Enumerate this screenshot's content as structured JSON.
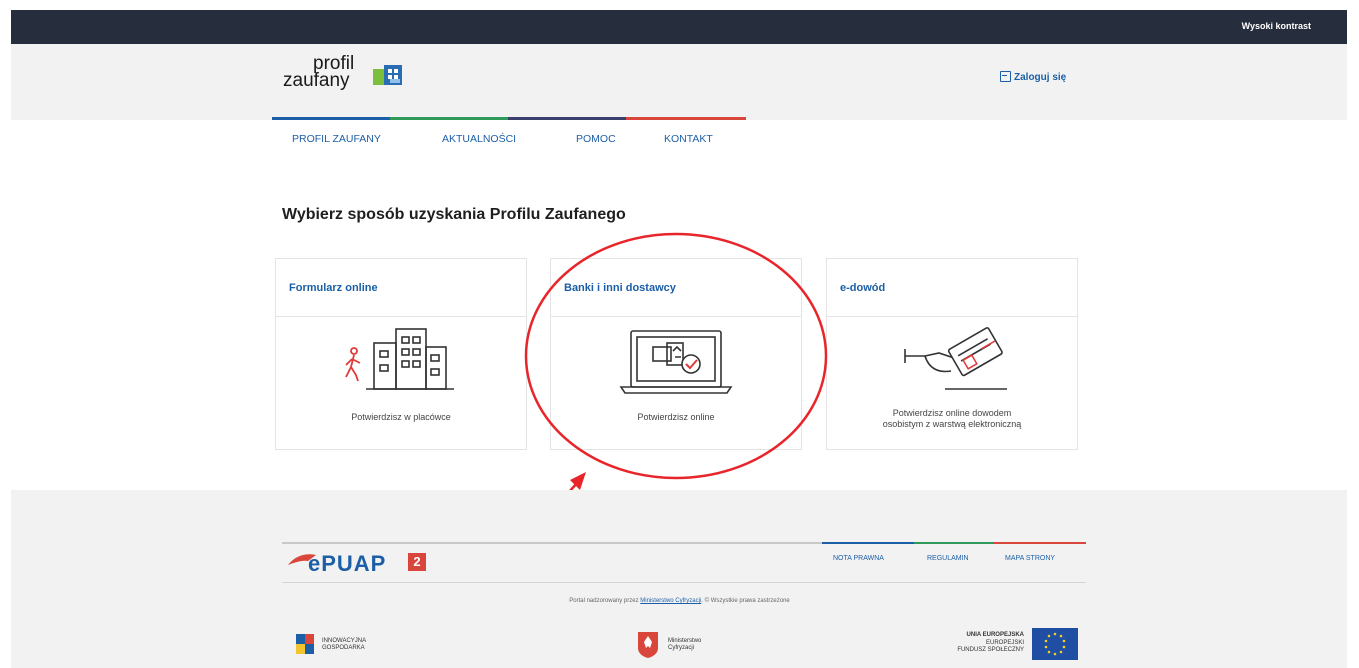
{
  "topbar": {
    "contrast_label": "Wysoki kontrast"
  },
  "header": {
    "logo_line1": "profil",
    "logo_line2": "zaufany",
    "login_label": "Zaloguj się"
  },
  "nav": {
    "items": [
      {
        "label": "PROFIL ZAUFANY"
      },
      {
        "label": "AKTUALNOŚCI"
      },
      {
        "label": "POMOC"
      },
      {
        "label": "KONTAKT"
      }
    ],
    "bar_colors": [
      "#1c5fa6",
      "#2f9a5a",
      "#3a3f6b",
      "#d9463b"
    ]
  },
  "main": {
    "title": "Wybierz sposób uzyskania Profilu Zaufanego",
    "cards": [
      {
        "title": "Formularz online",
        "caption": "Potwierdzisz w placówce",
        "icon": "office-building-icon"
      },
      {
        "title": "Banki i inni dostawcy",
        "caption": "Potwierdzisz online",
        "icon": "laptop-verified-icon"
      },
      {
        "title": "e-dowód",
        "caption_line1": "Potwierdzisz online dowodem",
        "caption_line2": "osobistym z warstwą elektroniczną",
        "icon": "id-card-hand-icon"
      }
    ]
  },
  "annotation": {
    "color": "#e8252b"
  },
  "footer": {
    "logo_text": "ePUAP",
    "logo_badge": "2",
    "links": [
      {
        "label": "NOTA PRAWNA"
      },
      {
        "label": "REGULAMIN"
      },
      {
        "label": "MAPA STRONY"
      }
    ],
    "note_prefix": "Portal nadzorowany przez",
    "note_link": "Ministerstwo Cyfryzacji",
    "note_suffix": ". © Wszystkie prawa zastrzeżone",
    "sponsors": {
      "ig_line1": "INNOWACYJNA",
      "ig_line2": "GOSPODARKA",
      "mc_line1": "Ministerstwo",
      "mc_line2": "Cyfryzacji",
      "ue_line1": "UNIA EUROPEJSKA",
      "ue_line2": "EUROPEJSKI",
      "ue_line3": "FUNDUSZ SPOŁECZNY"
    }
  }
}
